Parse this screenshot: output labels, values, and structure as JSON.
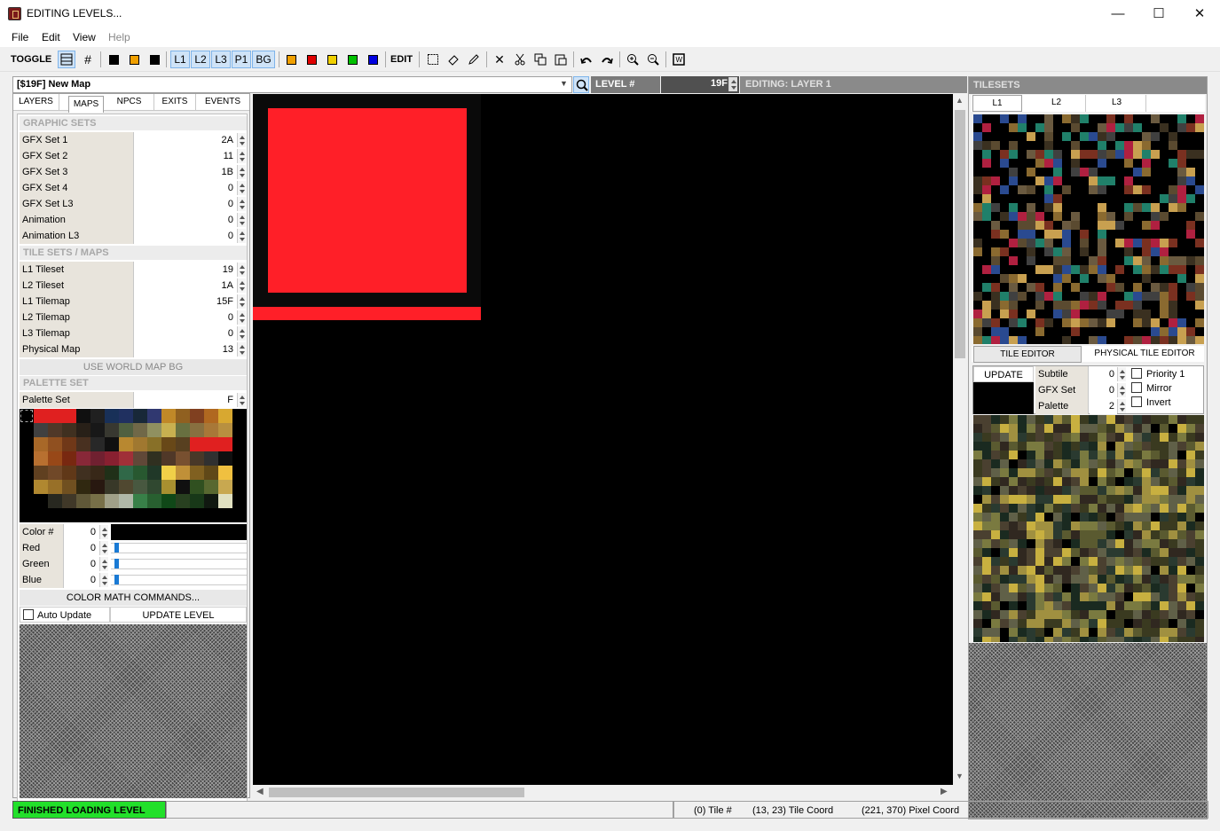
{
  "window": {
    "title": "EDITING LEVELS...",
    "buttons": [
      "minimize",
      "maximize",
      "close"
    ]
  },
  "menu": [
    "File",
    "Edit",
    "View",
    "Help"
  ],
  "toolbar": {
    "toggle_label": "TOGGLE",
    "edit_label": "EDIT",
    "layer_buttons": [
      "L1",
      "L2",
      "L3",
      "P1",
      "BG"
    ],
    "swatches_left": [
      "#000000",
      "#f0a000",
      "#000000"
    ],
    "swatches_right": [
      "#f0a000",
      "#e00000",
      "#f0d000",
      "#00c000",
      "#0000e0"
    ]
  },
  "map_header": {
    "title": "[$19F] New Map",
    "level_label": "LEVEL #",
    "level_value": "19F",
    "editing_label": "EDITING: LAYER 1"
  },
  "left_tabs": [
    "LAYERS",
    "MAPS",
    "NPCS",
    "EXITS",
    "EVENTS"
  ],
  "graphic_sets": {
    "header": "GRAPHIC SETS",
    "rows": [
      {
        "label": "GFX Set 1",
        "value": "2A"
      },
      {
        "label": "GFX Set 2",
        "value": "11"
      },
      {
        "label": "GFX Set 3",
        "value": "1B"
      },
      {
        "label": "GFX Set 4",
        "value": "0"
      },
      {
        "label": "GFX Set L3",
        "value": "0"
      },
      {
        "label": "Animation",
        "value": "0"
      },
      {
        "label": "Animation L3",
        "value": "0"
      }
    ]
  },
  "tile_sets": {
    "header": "TILE SETS / MAPS",
    "rows": [
      {
        "label": "L1 Tileset",
        "value": "19"
      },
      {
        "label": "L2 Tileset",
        "value": "1A"
      },
      {
        "label": "L1 Tilemap",
        "value": "15F"
      },
      {
        "label": "L2 Tilemap",
        "value": "0"
      },
      {
        "label": "L3 Tilemap",
        "value": "0"
      },
      {
        "label": "Physical Map",
        "value": "13"
      }
    ]
  },
  "world_map_button": "USE WORLD MAP BG",
  "palette": {
    "header": "PALETTE SET",
    "label": "Palette Set",
    "value": "F",
    "rows": [
      [
        "#000000",
        "#e02020",
        "#e02020",
        "#e02020",
        "#101010",
        "#202020",
        "#183058",
        "#203060",
        "#182838",
        "#303870",
        "#c08828",
        "#906020",
        "#804020",
        "#b06820",
        "#d8a830"
      ],
      [
        "#000000",
        "#404040",
        "#503828",
        "#403020",
        "#282018",
        "#181818",
        "#383830",
        "#506040",
        "#706848",
        "#909060",
        "#c8b050",
        "#687040",
        "#887040",
        "#a87838",
        "#b89040"
      ],
      [
        "#000000",
        "#a86828",
        "#905020",
        "#703818",
        "#483020",
        "#282828",
        "#101010",
        "#b88830",
        "#a07830",
        "#887028",
        "#684818",
        "#584020",
        "#e02020",
        "#e02020",
        "#e02020"
      ],
      [
        "#000000",
        "#b87030",
        "#984818",
        "#782810",
        "#882838",
        "#702030",
        "#882030",
        "#a03038",
        "#604838",
        "#303020",
        "#503828",
        "#785030",
        "#483828",
        "#303030",
        "#101010"
      ],
      [
        "#000000",
        "#604020",
        "#704828",
        "#603818",
        "#403020",
        "#382818",
        "#203018",
        "#306848",
        "#285830",
        "#203828",
        "#f0d048",
        "#c09038",
        "#806020",
        "#604818",
        "#f0c040"
      ],
      [
        "#000000",
        "#b08830",
        "#987028",
        "#705020",
        "#302810",
        "#281810",
        "#383828",
        "#504830",
        "#485840",
        "#304830",
        "#a89030",
        "#101010",
        "#305020",
        "#586830",
        "#c8a850"
      ],
      [
        "#000000",
        "#000000",
        "#282820",
        "#403828",
        "#605838",
        "#787048",
        "#a0a088",
        "#b0b8a8",
        "#388048",
        "#286030",
        "#104818",
        "#284020",
        "#183818",
        "#101810",
        "#e0e0c0"
      ]
    ]
  },
  "color": {
    "num_label": "Color #",
    "num_value": "0",
    "red_label": "Red",
    "red_value": "0",
    "green_label": "Green",
    "green_value": "0",
    "blue_label": "Blue",
    "blue_value": "0",
    "red_level": 0,
    "green_level": 0,
    "blue_level": 0
  },
  "color_math_button": "COLOR MATH COMMANDS...",
  "auto_update_label": "Auto Update",
  "update_level_button": "UPDATE LEVEL",
  "tilesets": {
    "header": "TILESETS",
    "tabs": [
      "L1",
      "L2",
      "L3"
    ],
    "editor_tabs": [
      "TILE EDITOR",
      "PHYSICAL TILE EDITOR"
    ]
  },
  "tile_editor": {
    "update_button": "UPDATE",
    "subtile_label": "Subtile",
    "subtile_value": "0",
    "gfx_label": "GFX Set",
    "gfx_value": "0",
    "palette_label": "Palette",
    "palette_value": "2",
    "priority_label": "Priority 1",
    "mirror_label": "Mirror",
    "invert_label": "Invert"
  },
  "status": {
    "message": "FINISHED LOADING LEVEL",
    "tile": "(0)  Tile #",
    "tile_coord": "(13, 23)  Tile Coord",
    "pixel_coord": "(221, 370)  Pixel Coord"
  }
}
